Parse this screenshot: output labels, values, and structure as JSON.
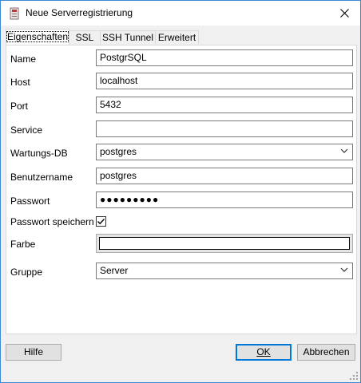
{
  "window": {
    "title": "Neue Serverregistrierung"
  },
  "tabs": [
    {
      "label": "Eigenschaften"
    },
    {
      "label": "SSL"
    },
    {
      "label": "SSH Tunnel"
    },
    {
      "label": "Erweitert"
    }
  ],
  "form": {
    "name": {
      "label": "Name",
      "value": "PostgrSQL"
    },
    "host": {
      "label": "Host",
      "value": "localhost"
    },
    "port": {
      "label": "Port",
      "value": "5432"
    },
    "service": {
      "label": "Service",
      "value": ""
    },
    "maintenance_db": {
      "label": "Wartungs-DB",
      "value": "postgres"
    },
    "username": {
      "label": "Benutzername",
      "value": "postgres"
    },
    "password": {
      "label": "Passwort",
      "value": "●●●●●●●●●"
    },
    "save_password": {
      "label": "Passwort speichern",
      "checked": true
    },
    "color": {
      "label": "Farbe"
    },
    "group": {
      "label": "Gruppe",
      "value": "Server"
    }
  },
  "buttons": {
    "help": "Hilfe",
    "ok": "OK",
    "cancel": "Abbrechen"
  },
  "colors": {
    "window_border": "#3c8ad6",
    "focus_border": "#0078d7"
  }
}
